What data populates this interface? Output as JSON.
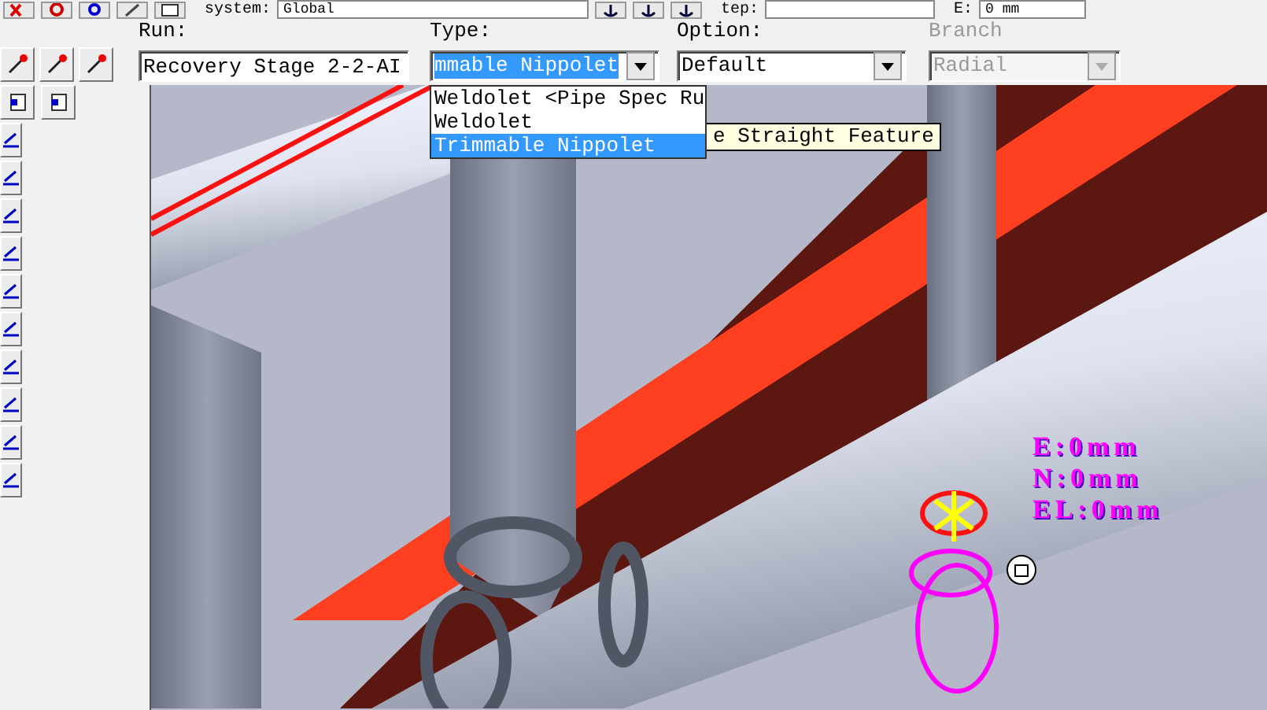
{
  "toolbar": {
    "system_label": "system:",
    "system_value": "Global",
    "step_label": "tep:",
    "e_label": "E:",
    "e_value": "0 mm"
  },
  "run": {
    "label": "Run:",
    "value": "Recovery Stage 2-2-AI"
  },
  "type": {
    "label": "Type:",
    "value": "mmable Nippolet",
    "expanded": true,
    "options": [
      {
        "label": "Weldolet <Pipe Spec Ru",
        "selected": false
      },
      {
        "label": "Weldolet",
        "selected": false
      },
      {
        "label": "Trimmable Nippolet",
        "selected": true
      }
    ]
  },
  "option": {
    "label": "Option:",
    "value": "Default"
  },
  "branch": {
    "label": "Branch",
    "value": "Radial",
    "disabled": true
  },
  "tooltip": "e Straight Feature",
  "coordinates": [
    "E:0mm",
    "N:0mm",
    "EL:0mm"
  ]
}
